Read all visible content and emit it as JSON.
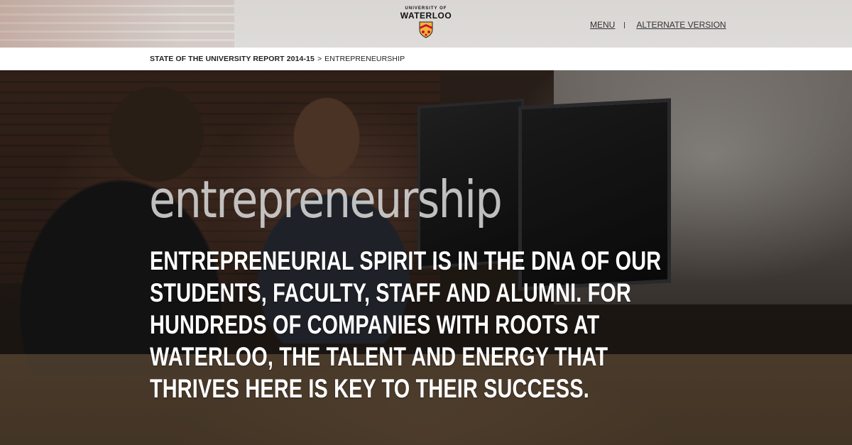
{
  "header": {
    "logo": {
      "top_text": "UNIVERSITY OF",
      "main_text": "WATERLOO"
    },
    "nav": {
      "menu_label": "MENU",
      "alternate_label": "ALTERNATE VERSION"
    }
  },
  "breadcrumb": {
    "parent": "STATE OF THE UNIVERSITY REPORT 2014-15",
    "separator": ">",
    "current": "ENTREPRENEURSHIP"
  },
  "hero": {
    "title": "entrepreneurship",
    "lines": [
      "ENTREPRENEURIAL SPIRIT IS IN THE DNA OF OUR",
      "STUDENTS, FACULTY, STAFF AND ALUMNI. FOR",
      "HUNDREDS OF COMPANIES WITH ROOTS AT",
      "WATERLOO, THE TALENT AND ENERGY THAT",
      "THRIVES HERE IS KEY TO THEIR SUCCESS."
    ]
  },
  "colors": {
    "shield_gold": "#f2b43a",
    "shield_red": "#c8102e",
    "headline": "#ffffff",
    "title": "#d7d7d7"
  }
}
